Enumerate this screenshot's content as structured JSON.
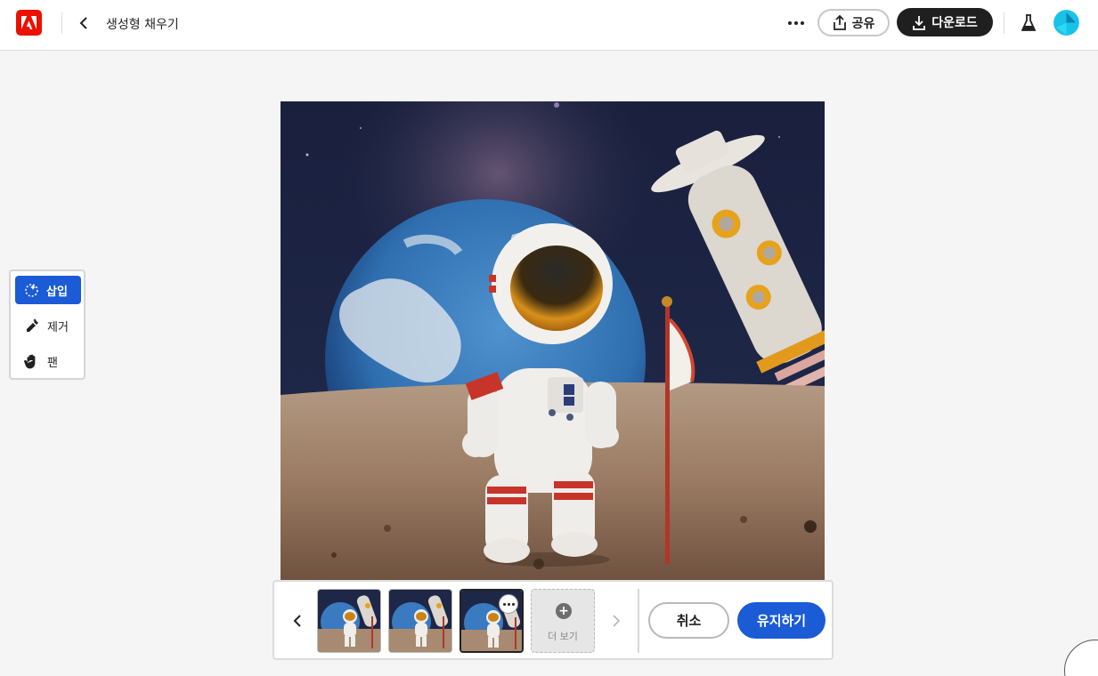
{
  "header": {
    "title": "생성형 채우기",
    "share_label": "공유",
    "download_label": "다운로드",
    "icons": {
      "logo": "adobe-logo",
      "back": "chevron-left-icon",
      "more": "more-horizontal-icon",
      "share": "share-icon",
      "download": "download-icon",
      "labs": "flask-icon",
      "avatar": "user-avatar"
    }
  },
  "tools": {
    "items": [
      {
        "label": "삽입",
        "icon": "insert-brush-icon",
        "active": true
      },
      {
        "label": "제거",
        "icon": "remove-eraser-icon",
        "active": false
      },
      {
        "label": "팬",
        "icon": "hand-icon",
        "active": false
      }
    ]
  },
  "variations": {
    "selected_index": 2,
    "count": 3,
    "more_label": "더 보기",
    "cancel_label": "취소",
    "keep_label": "유지하기"
  },
  "colors": {
    "brand_red": "#eb1000",
    "accent_blue": "#1b5bd6",
    "dark_button": "#1f1f1f"
  }
}
